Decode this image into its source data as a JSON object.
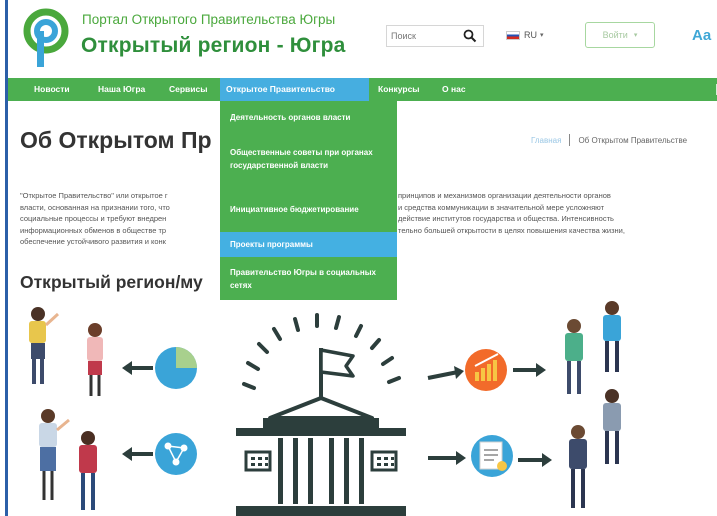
{
  "header": {
    "brand_top": "Портал Открытого Правительства Югры",
    "brand_main": "Открытый регион - Югра",
    "search_placeholder": "Поиск",
    "language": "RU",
    "login_label": "Войти",
    "font_size_label": "Aa"
  },
  "nav": {
    "items": [
      {
        "label": "Новости"
      },
      {
        "label": "Наша Югра"
      },
      {
        "label": "Сервисы"
      },
      {
        "label": "Открытое Правительство"
      },
      {
        "label": "Конкурсы"
      },
      {
        "label": "О нас"
      }
    ],
    "active_index": 3
  },
  "dropdown": {
    "items": [
      {
        "label": "Деятельность органов власти"
      },
      {
        "label": "Общественные советы при органах государственной власти"
      },
      {
        "label": "Инициативное бюджетирование"
      },
      {
        "label": "Проекты программы"
      },
      {
        "label": "Правительство Югры в социальных сетях"
      }
    ],
    "highlighted_index": 3
  },
  "page": {
    "title": "Об Открытом Пр",
    "breadcrumb_home": "Главная",
    "breadcrumb_current": "Об Открытом Правительстве",
    "paragraph_left": [
      "\"Открытое Правительство\" или открытое г",
      "власти, основанная на признании того, что",
      "социальные процессы и требуют внедрен",
      "информационных обменов в обществе тр",
      "обеспечение устойчивого развития и конк"
    ],
    "paragraph_right": [
      "принципов и механизмов организации деятельности органов",
      "и средства коммуникации в значительной мере усложняют",
      "действие институтов государства и общества. Интенсивность",
      "тельно большей открытости в целях повышения качества жизни,",
      ""
    ],
    "section_title": "Открытый регион/му"
  },
  "colors": {
    "nav_green": "#4caf50",
    "brand_green": "#2f8f3c",
    "highlight_blue": "#44b0e2",
    "frame_blue": "#2b5fa8",
    "building_dark": "#2c3e3c",
    "icon_blue": "#3aa4d8",
    "icon_orange": "#f26b2a"
  }
}
